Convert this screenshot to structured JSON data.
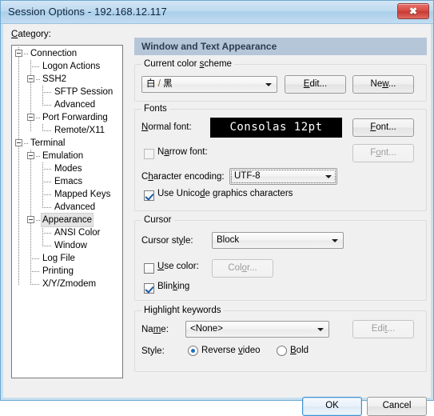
{
  "window": {
    "title": "Session Options - 192.168.12.117",
    "close_glyph": "✖"
  },
  "category": {
    "label": "Category:",
    "tree": [
      {
        "label": "Connection",
        "depth": 0,
        "expander": "minus",
        "selected": false
      },
      {
        "label": "Logon Actions",
        "depth": 1,
        "expander": "none",
        "selected": false
      },
      {
        "label": "SSH2",
        "depth": 1,
        "expander": "minus",
        "selected": false
      },
      {
        "label": "SFTP Session",
        "depth": 2,
        "expander": "none",
        "selected": false
      },
      {
        "label": "Advanced",
        "depth": 2,
        "expander": "none",
        "selected": false
      },
      {
        "label": "Port Forwarding",
        "depth": 1,
        "expander": "minus",
        "selected": false
      },
      {
        "label": "Remote/X11",
        "depth": 2,
        "expander": "none",
        "selected": false
      },
      {
        "label": "Terminal",
        "depth": 0,
        "expander": "minus",
        "selected": false
      },
      {
        "label": "Emulation",
        "depth": 1,
        "expander": "minus",
        "selected": false
      },
      {
        "label": "Modes",
        "depth": 2,
        "expander": "none",
        "selected": false
      },
      {
        "label": "Emacs",
        "depth": 2,
        "expander": "none",
        "selected": false
      },
      {
        "label": "Mapped Keys",
        "depth": 2,
        "expander": "none",
        "selected": false
      },
      {
        "label": "Advanced",
        "depth": 2,
        "expander": "none",
        "selected": false
      },
      {
        "label": "Appearance",
        "depth": 1,
        "expander": "minus",
        "selected": true
      },
      {
        "label": "ANSI Color",
        "depth": 2,
        "expander": "none",
        "selected": false
      },
      {
        "label": "Window",
        "depth": 2,
        "expander": "none",
        "selected": false
      },
      {
        "label": "Log File",
        "depth": 1,
        "expander": "none",
        "selected": false
      },
      {
        "label": "Printing",
        "depth": 1,
        "expander": "none",
        "selected": false
      },
      {
        "label": "X/Y/Zmodem",
        "depth": 1,
        "expander": "none",
        "selected": false
      }
    ]
  },
  "pane": {
    "header": "Window and Text Appearance",
    "color_scheme": {
      "group_title": "Current color scheme",
      "value": "白 / 黑",
      "edit_label": "Edit...",
      "new_label": "New..."
    },
    "fonts": {
      "group_title": "Fonts",
      "normal_font_label": "Normal font:",
      "normal_font_value": "Consolas 12pt",
      "normal_font_button": "Font...",
      "narrow_font_label": "Narrow font:",
      "narrow_font_checked": false,
      "narrow_font_button": "Font...",
      "encoding_label": "Character encoding:",
      "encoding_value": "UTF-8",
      "unicode_graphics_label": "Use Unicode graphics characters",
      "unicode_graphics_checked": true
    },
    "cursor": {
      "group_title": "Cursor",
      "style_label": "Cursor style:",
      "style_value": "Block",
      "use_color_label": "Use color:",
      "use_color_checked": false,
      "color_button": "Color...",
      "blinking_label": "Blinking",
      "blinking_checked": true
    },
    "highlight": {
      "group_title": "Highlight keywords",
      "name_label": "Name:",
      "name_value": "<None>",
      "edit_label": "Edit...",
      "style_label": "Style:",
      "option_reverse": "Reverse video",
      "option_bold": "Bold",
      "selected_style": "Reverse video"
    }
  },
  "footer": {
    "ok_label": "OK",
    "cancel_label": "Cancel"
  },
  "colors": {
    "titlebar_accent": "#aacfe9",
    "header_bg": "#b6c6d9",
    "header_fg": "#2d3c4e",
    "close_red": "#d64b43",
    "default_button_border": "#3f93d4",
    "font_preview_bg": "#000000",
    "font_preview_fg": "#ffffff"
  }
}
